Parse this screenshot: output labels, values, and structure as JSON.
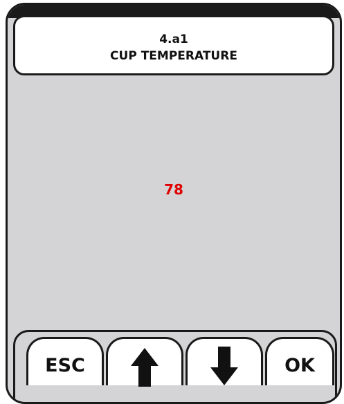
{
  "header": {
    "code": "4.a1",
    "title": "CUP TEMPERATURE"
  },
  "display": {
    "value": "78",
    "value_color": "#e00000"
  },
  "buttons": {
    "esc_label": "ESC",
    "up_icon": "arrow-up-icon",
    "down_icon": "arrow-down-icon",
    "ok_label": "OK"
  }
}
